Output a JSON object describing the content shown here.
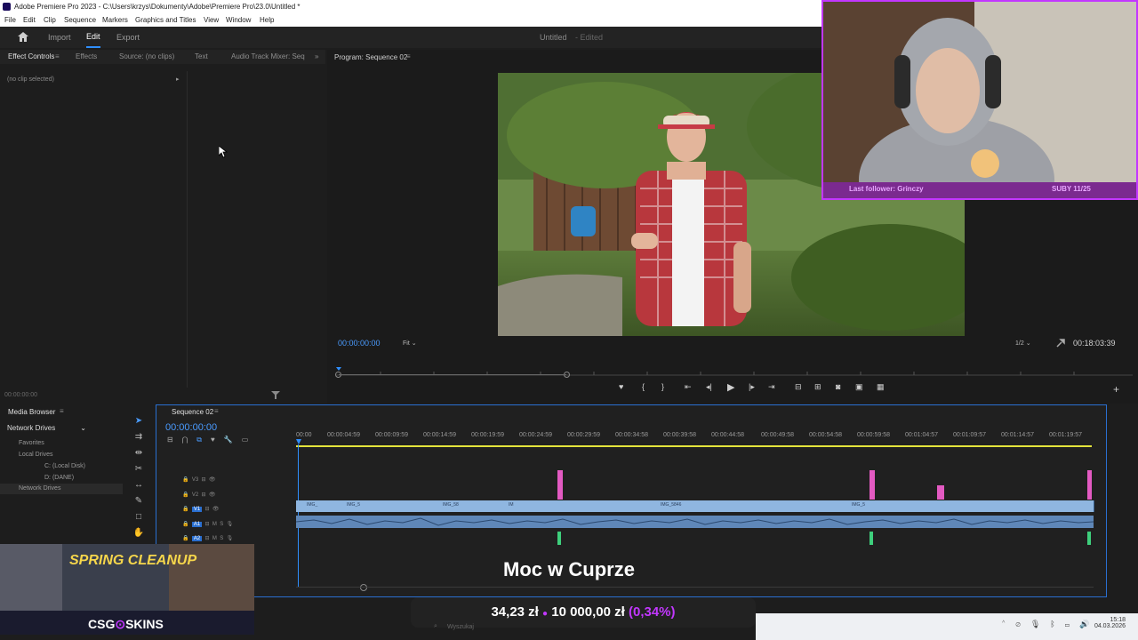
{
  "window": {
    "title": "Adobe Premiere Pro 2023 - C:\\Users\\krzys\\Dokumenty\\Adobe\\Premiere Pro\\23.0\\Untitled *"
  },
  "menu": [
    "File",
    "Edit",
    "Clip",
    "Sequence",
    "Markers",
    "Graphics and Titles",
    "View",
    "Window",
    "Help"
  ],
  "modes": {
    "home": "home-icon",
    "import": "Import",
    "edit": "Edit",
    "export": "Export",
    "project_name": "Untitled",
    "project_state": "- Edited"
  },
  "left_panel": {
    "tabs": [
      "Effect Controls",
      "Effects",
      "Source: (no clips)",
      "Text",
      "Audio Track Mixer: Seq"
    ],
    "no_clip": "(no clip selected)",
    "timecode": "00:00:00:00"
  },
  "program": {
    "tab": "Program: Sequence 02",
    "timecode": "00:00:00:00",
    "fit": "Fit",
    "resolution": "1/2",
    "duration": "00:18:03:39",
    "playhead_fraction": 0.0
  },
  "media_browser": {
    "tab": "Media Browser",
    "dropdown": "Network Drives",
    "items": [
      "Favorites",
      "Local Drives",
      "C: (Local Disk)",
      "D: (DANE)",
      "Network Drives"
    ]
  },
  "timeline": {
    "tab": "Sequence 02",
    "timecode": "00:00:00:00",
    "ruler": [
      "00:00",
      "00:00:04:59",
      "00:00:09:59",
      "00:00:14:59",
      "00:00:19:59",
      "00:00:24:59",
      "00:00:29:59",
      "00:00:34:58",
      "00:00:39:58",
      "00:00:44:58",
      "00:00:49:58",
      "00:00:54:58",
      "00:00:59:58",
      "00:01:04:57",
      "00:01:09:57",
      "00:01:14:57",
      "00:01:19:57"
    ],
    "tracks": [
      "V3",
      "V2",
      "V1",
      "A1",
      "A2"
    ],
    "clip_labels": [
      "IMG_",
      "IMG_5",
      "IMG_58",
      "IM",
      "IMG_5846",
      "IMG_5"
    ]
  },
  "webcam": {
    "last_follower": "Last follower: Grinczy",
    "subs": "SUBY 11/25"
  },
  "overlay": {
    "title": "Moc w Cuprze",
    "donation_current": "34,23 zł",
    "donation_goal": "10 000,00 zł",
    "donation_percent": "(0,34%)"
  },
  "ad": {
    "headline": "SPRING CLEANUP",
    "brand": "CSG",
    "brand2": "SKINS"
  },
  "taskbar": {
    "search_placeholder": "Wyszukaj",
    "time": "15:18",
    "date": "04.03.2026"
  },
  "colors": {
    "accent": "#2f8fff",
    "playhead": "#2f8fff",
    "stream_border": "#c237ff"
  }
}
